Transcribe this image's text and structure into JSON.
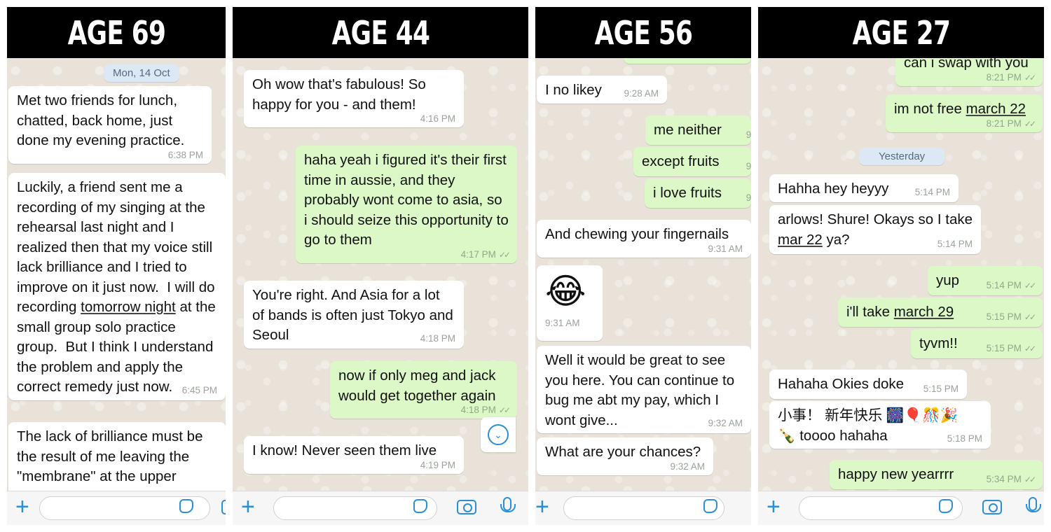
{
  "panels": [
    {
      "header": "AGE 69",
      "date_chip": "Mon, 14 Oct",
      "messages": [
        {
          "text": "Met two friends for lunch, chatted, back home, just done my evening practice.",
          "time": "6:38 PM"
        },
        {
          "text_before": "Luckily, a friend sent me a recording of my singing at the rehearsal last night and I realized then that my voice still lack brilliance and I tried to improve on it just now.  I will do recording ",
          "link": "tomorrow night",
          "text_after": " at the small group solo practice group.  But I think I understand the problem and apply the correct remedy just now.",
          "time": "6:45 PM"
        },
        {
          "text": "The lack of brilliance must be the result of me leaving the \"membrane\" at the upper"
        }
      ]
    },
    {
      "header": "AGE 44",
      "messages": [
        {
          "text": "Oh wow that's fabulous! So happy for you - and them!",
          "time": "4:16 PM"
        },
        {
          "text": "haha yeah i figured it's their first time in aussie, and they probably wont come to asia, so i should seize this opportunity to go to them",
          "time": "4:17 PM"
        },
        {
          "text": "You're right. And Asia for a lot of bands is often just Tokyo and Seoul",
          "time": "4:18 PM"
        },
        {
          "text": "now if only meg and jack would get together again",
          "time": "4:18 PM"
        },
        {
          "text": "I know! Never seen them live",
          "time": "4:19 PM"
        }
      ]
    },
    {
      "header": "AGE 56",
      "messages": [
        {
          "text": "I no likey",
          "time": "9:28 AM"
        },
        {
          "text": "me neither",
          "time": "9:"
        },
        {
          "text": "except fruits",
          "time": "9:"
        },
        {
          "text": "i love fruits",
          "time": "9:"
        },
        {
          "text": "And chewing your fingernails",
          "time": "9:31 AM"
        },
        {
          "text": "😂",
          "time": "9:31 AM"
        },
        {
          "text": "Well it would be great to see you here. You can continue to bug me abt my pay, which I wont give...",
          "time": "9:32 AM"
        },
        {
          "text": "What are your chances?",
          "time": "9:32 AM"
        }
      ]
    },
    {
      "header": "AGE 27",
      "date_chip": "Yesterday",
      "messages": [
        {
          "text": "can i swap with you",
          "time": "8:21 PM"
        },
        {
          "text_before": "im not free ",
          "link": "march 22",
          "time": "8:21 PM"
        },
        {
          "text": "Hahha hey heyyy",
          "time": "5:14 PM"
        },
        {
          "text_before": "arlows! Shure! Okays so I take ",
          "link": "mar 22",
          "text_after": " ya?",
          "time": "5:14 PM"
        },
        {
          "text": "yup",
          "time": "5:14 PM"
        },
        {
          "text_before": "i'll take ",
          "link": "march 29",
          "time": "5:15 PM"
        },
        {
          "text": "tyvm!!",
          "time": "5:15 PM"
        },
        {
          "text": "Hahaha Okies doke",
          "time": "5:15 PM"
        },
        {
          "text": "小事！ 新年快乐 🎆🎈🎊🎉 🍾 toooo hahaha",
          "time": "5:18 PM"
        },
        {
          "text": "happy new yearrrr",
          "time": "5:34 PM"
        }
      ]
    }
  ],
  "ticks": "✓✓",
  "plus_glyph": "+",
  "scroll_glyph": "⌄",
  "colors": {
    "incoming": "#ffffff",
    "outgoing": "#dcf8c6",
    "accent": "#2b8fd8",
    "chat_bg": "#e8e2d8",
    "header_bg": "#000000"
  }
}
